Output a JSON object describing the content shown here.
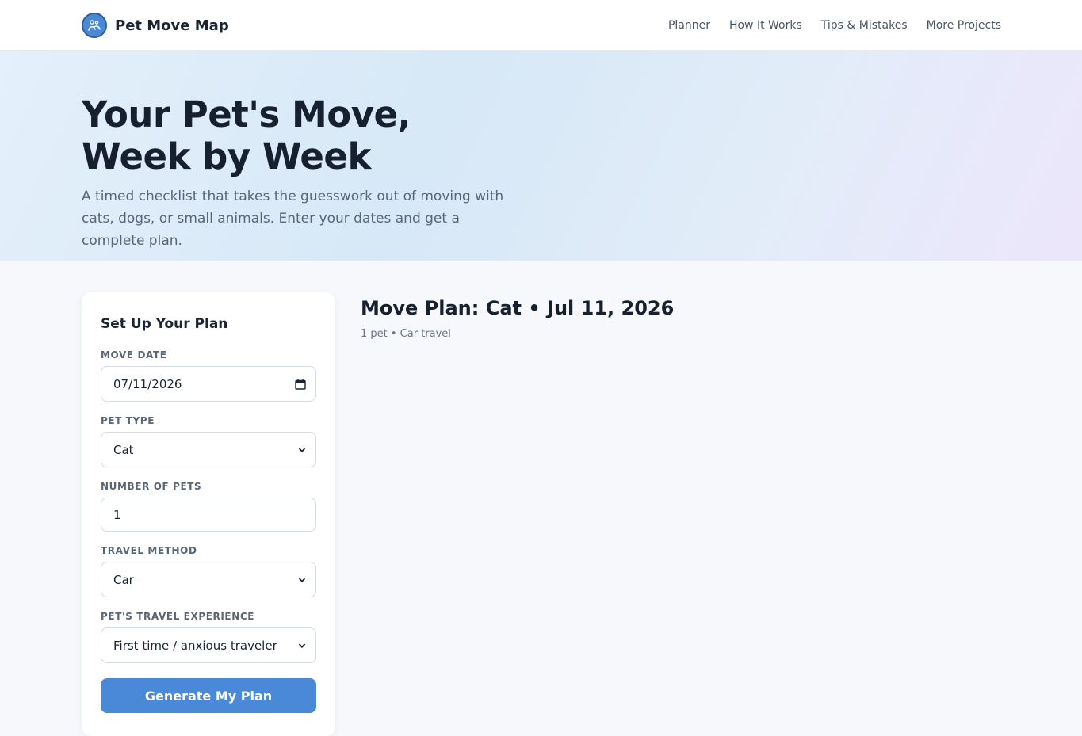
{
  "nav": {
    "brand": "Pet Move Map",
    "links": [
      "Planner",
      "How It Works",
      "Tips & Mistakes",
      "More Projects"
    ]
  },
  "hero": {
    "title_line1": "Your Pet's Move,",
    "title_line2": "Week by Week",
    "subtitle": "A timed checklist that takes the guesswork out of moving with cats, dogs, or small animals. Enter your dates and get a complete plan."
  },
  "form": {
    "title": "Set Up Your Plan",
    "move_date_label": "Move Date",
    "move_date_value": "07/11/2026",
    "pet_type_label": "Pet Type",
    "pet_type_value": "Cat",
    "num_pets_label": "Number of Pets",
    "num_pets_value": "1",
    "travel_method_label": "Travel Method",
    "travel_method_value": "Car",
    "experience_label": "Pet's Travel Experience",
    "experience_value": "First time / anxious traveler",
    "generate_label": "Generate My Plan"
  },
  "plan": {
    "title": "Move Plan: Cat • Jul 11, 2026",
    "meta": "1 pet • Car travel"
  },
  "colors": {
    "accent": "#4a89d8",
    "text": "#1a2433",
    "muted": "#5a6577"
  }
}
